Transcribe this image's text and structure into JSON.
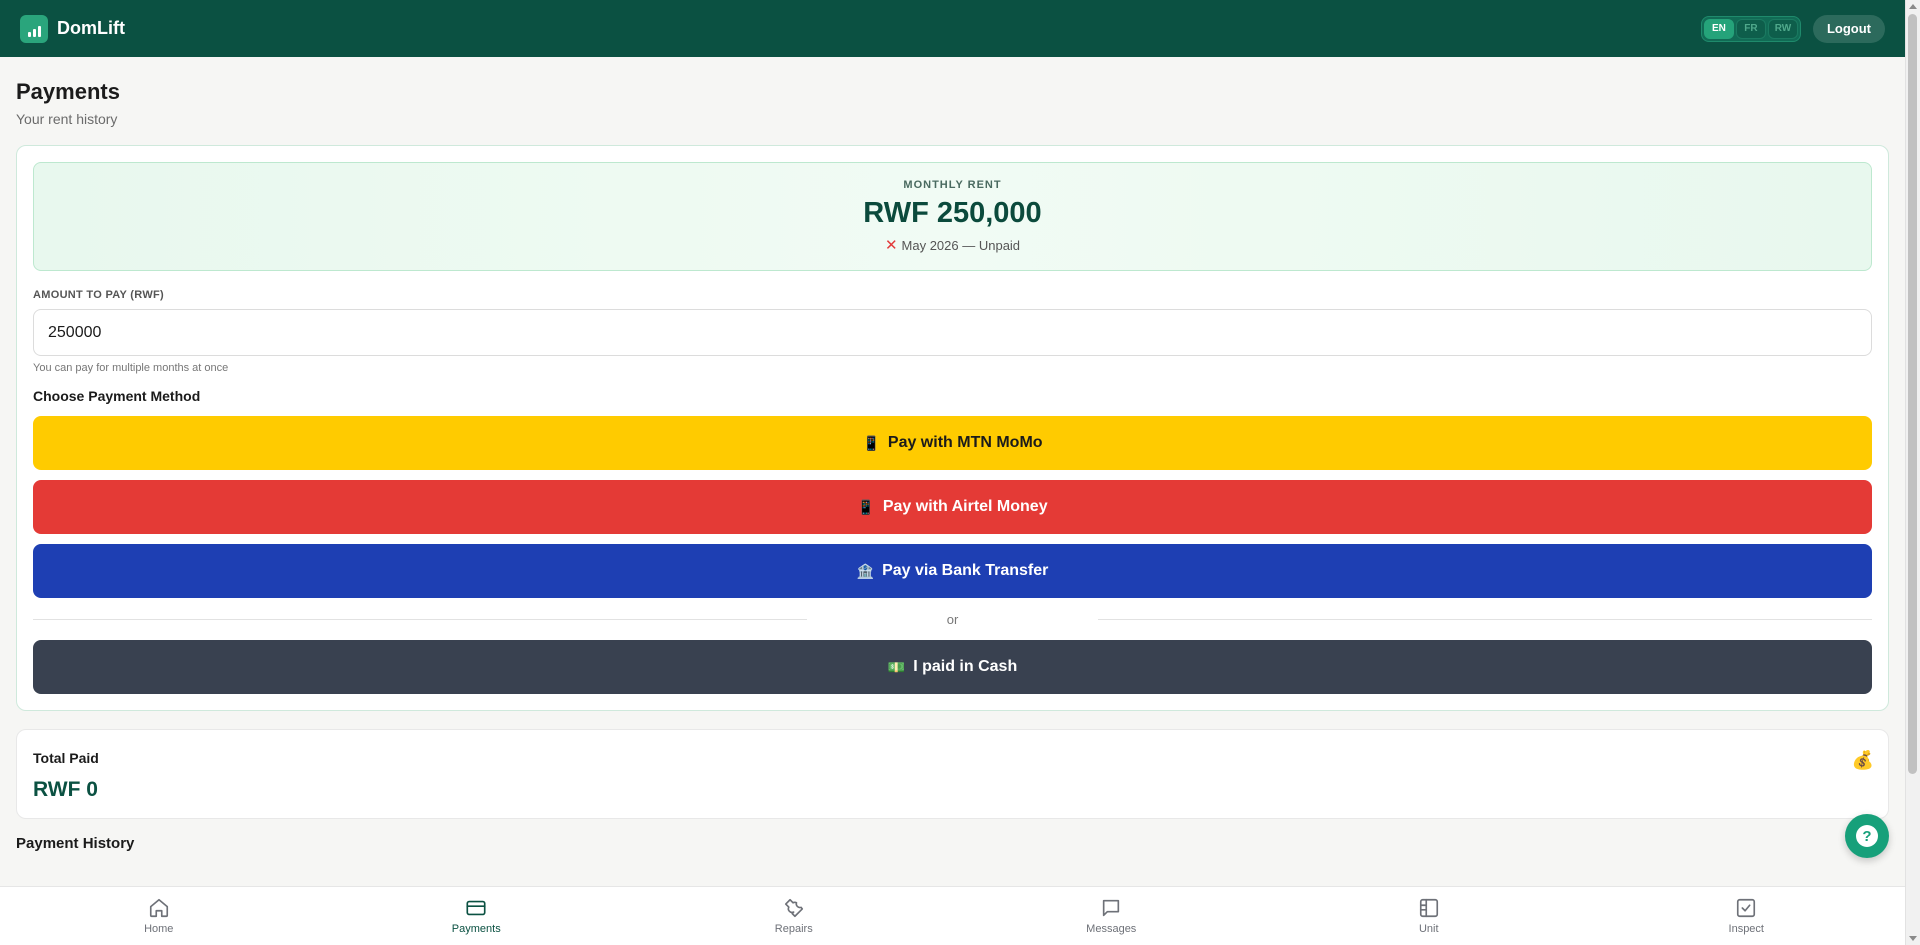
{
  "header": {
    "brand": "DomLift",
    "languages": [
      {
        "code": "EN",
        "active": true
      },
      {
        "code": "FR",
        "active": false
      },
      {
        "code": "RW",
        "active": false
      }
    ],
    "logout_label": "Logout"
  },
  "page": {
    "title": "Payments",
    "subtitle": "Your rent history"
  },
  "rent": {
    "label": "MONTHLY RENT",
    "amount": "RWF 250,000",
    "status": "May 2026 — Unpaid",
    "status_icon": "x-icon"
  },
  "payment_form": {
    "amount_label": "AMOUNT TO PAY (RWF)",
    "amount_value": "250000",
    "hint": "You can pay for multiple months at once",
    "method_label": "Choose Payment Method",
    "methods": [
      {
        "label": "Pay with MTN MoMo",
        "icon": "📱",
        "color": "#ffcb00"
      },
      {
        "label": "Pay with Airtel Money",
        "icon": "📱",
        "color": "#e43a36"
      },
      {
        "label": "Pay via Bank Transfer",
        "icon": "🏦",
        "color": "#1e3fb3"
      }
    ],
    "or_label": "or",
    "cash": {
      "label": "I paid in Cash",
      "icon": "💵",
      "color": "#394150"
    }
  },
  "totals": {
    "label": "Total Paid",
    "value": "RWF 0",
    "icon": "💰"
  },
  "history": {
    "title": "Payment History"
  },
  "bottom_nav": [
    {
      "label": "Home",
      "icon": "home-icon",
      "active": false
    },
    {
      "label": "Payments",
      "icon": "card-icon",
      "active": true
    },
    {
      "label": "Repairs",
      "icon": "wrench-icon",
      "active": false
    },
    {
      "label": "Messages",
      "icon": "message-icon",
      "active": false
    },
    {
      "label": "Unit",
      "icon": "unit-icon",
      "active": false
    },
    {
      "label": "Inspect",
      "icon": "checkbox-icon",
      "active": false
    }
  ],
  "colors": {
    "header_bg": "#0b5142",
    "accent": "#17a07a"
  }
}
